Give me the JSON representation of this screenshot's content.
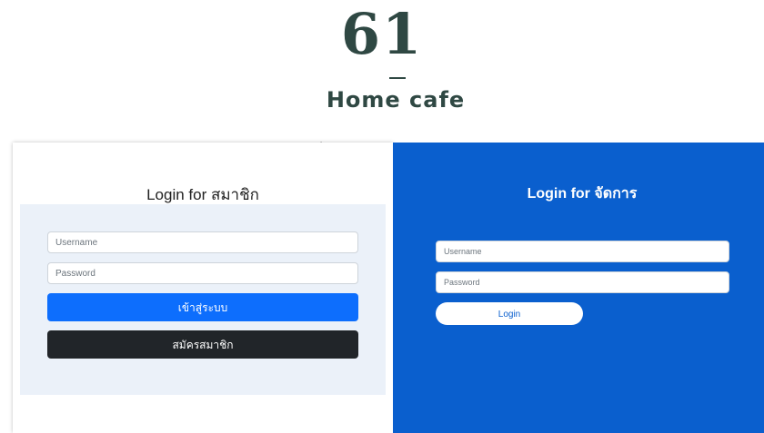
{
  "brand": {
    "mark": "61",
    "name": "Home cafe"
  },
  "member_login": {
    "title": "Login for สมาชิก",
    "username_placeholder": "Username",
    "password_placeholder": "Password",
    "login_label": "เข้าสู่ระบบ",
    "register_label": "สมัครสมาชิก"
  },
  "admin_login": {
    "title": "Login for จัดการ",
    "username_placeholder": "Username",
    "password_placeholder": "Password",
    "login_label": "Login"
  },
  "colors": {
    "brand_text": "#2f4843",
    "admin_panel": "#0a5fce",
    "primary_button": "#0d6efd",
    "dark_button": "#212529",
    "form_background": "#ebf1f9"
  }
}
